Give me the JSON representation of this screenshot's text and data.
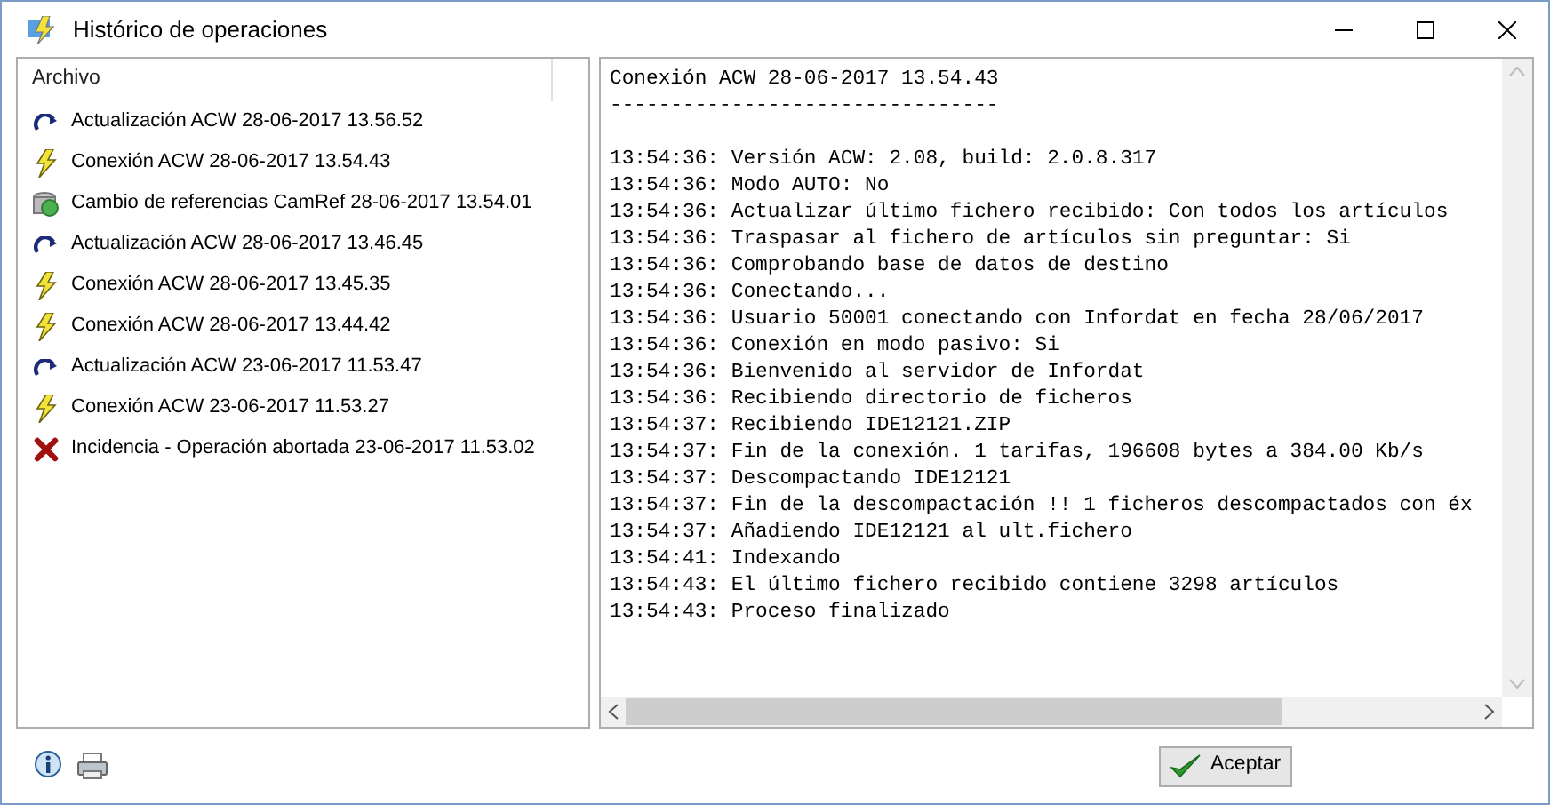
{
  "window": {
    "title": "Histórico de operaciones"
  },
  "list": {
    "header": "Archivo",
    "items": [
      {
        "kind": "update",
        "label": "Actualización ACW 28-06-2017 13.56.52"
      },
      {
        "kind": "connection",
        "label": "Conexión ACW 28-06-2017 13.54.43"
      },
      {
        "kind": "refs",
        "label": "Cambio de referencias CamRef 28-06-2017 13.54.01"
      },
      {
        "kind": "update",
        "label": "Actualización ACW 28-06-2017 13.46.45"
      },
      {
        "kind": "connection",
        "label": "Conexión ACW 28-06-2017 13.45.35"
      },
      {
        "kind": "connection",
        "label": "Conexión ACW 28-06-2017 13.44.42"
      },
      {
        "kind": "update",
        "label": "Actualización ACW 23-06-2017 11.53.47"
      },
      {
        "kind": "connection",
        "label": "Conexión ACW 23-06-2017 11.53.27"
      },
      {
        "kind": "error",
        "label": "Incidencia - Operación abortada 23-06-2017 11.53.02"
      }
    ]
  },
  "log": {
    "title": "Conexión ACW 28-06-2017 13.54.43",
    "separator": "--------------------------------",
    "lines": [
      "13:54:36: Versión ACW: 2.08, build: 2.0.8.317",
      "13:54:36: Modo AUTO: No",
      "13:54:36: Actualizar último fichero recibido: Con todos los artículos",
      "13:54:36: Traspasar al fichero de artículos sin preguntar: Si",
      "13:54:36: Comprobando base de datos de destino",
      "13:54:36: Conectando...",
      "13:54:36: Usuario 50001 conectando con Infordat en fecha 28/06/2017",
      "13:54:36: Conexión en modo pasivo: Si",
      "13:54:36: Bienvenido al servidor de Infordat",
      "13:54:36: Recibiendo directorio de ficheros",
      "13:54:37: Recibiendo IDE12121.ZIP",
      "13:54:37: Fin de la conexión. 1 tarifas, 196608 bytes a 384.00 Kb/s",
      "13:54:37: Descompactando IDE12121",
      "13:54:37: Fin de la descompactación !! 1 ficheros descompactados con éx",
      "13:54:37: Añadiendo IDE12121 al ult.fichero",
      "13:54:41: Indexando",
      "13:54:43: El último fichero recibido contiene 3298 artículos",
      "13:54:43: Proceso finalizado"
    ]
  },
  "footer": {
    "ok_button": "Aceptar"
  }
}
